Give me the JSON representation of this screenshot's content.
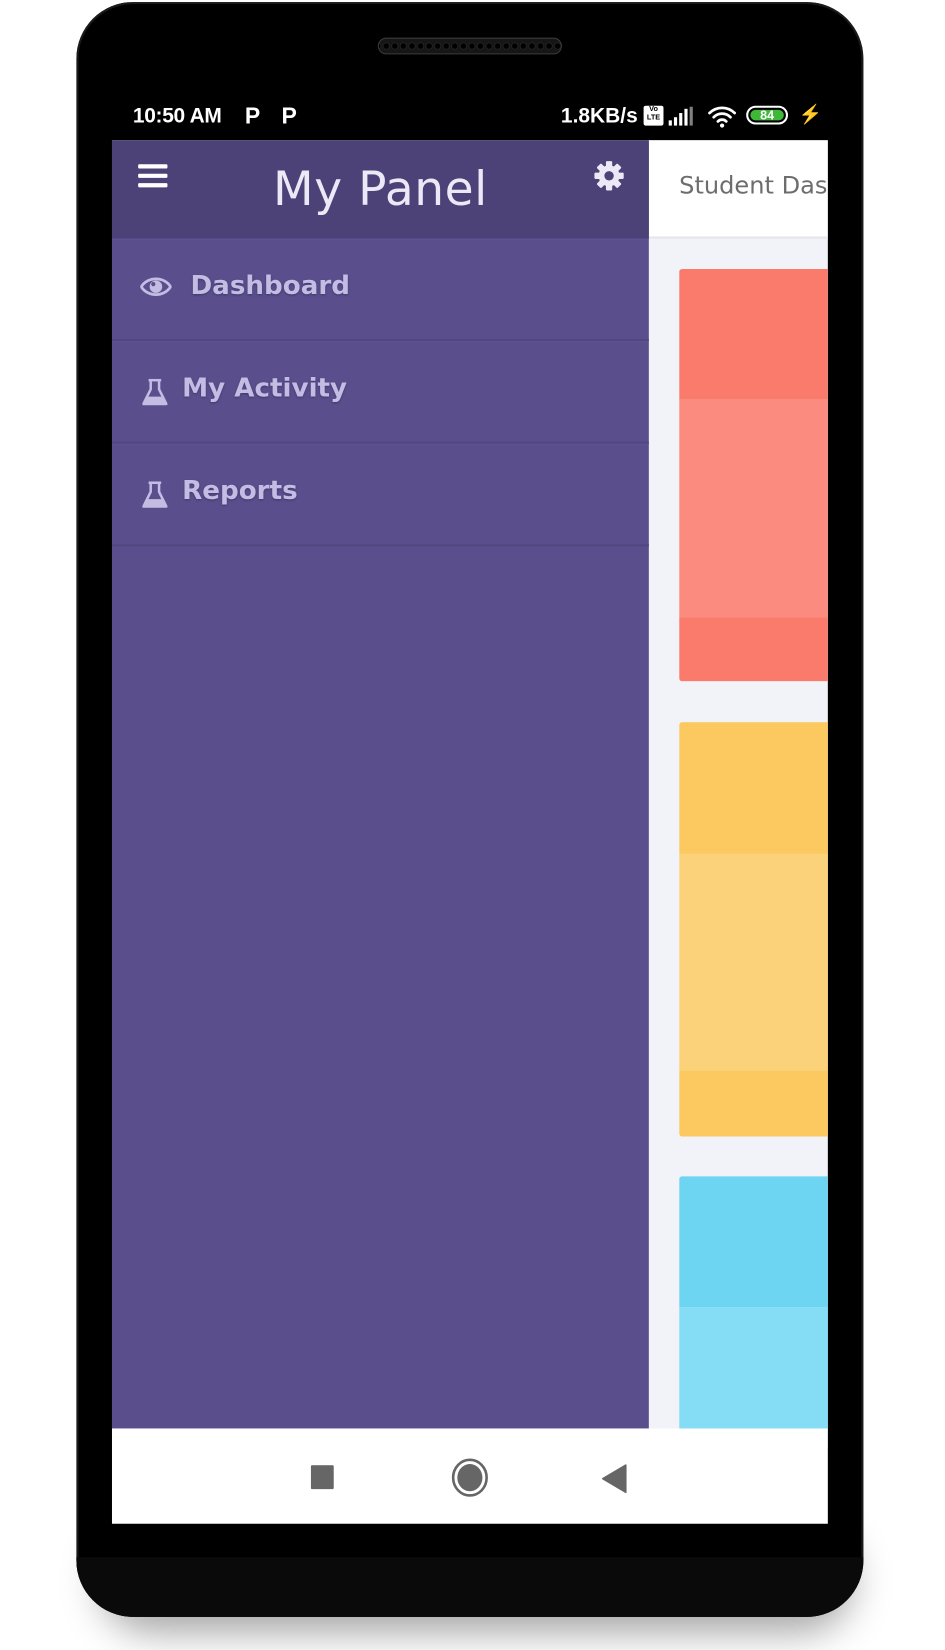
{
  "status_bar": {
    "time": "10:50 AM",
    "notification_icons": [
      "P",
      "P"
    ],
    "network_speed": "1.8KB/s",
    "volte_label": "Vo LTE",
    "battery_level": "84",
    "charging": true
  },
  "drawer": {
    "title": "My Panel",
    "menu_icon": "hamburger-icon",
    "settings_icon": "gear-icon",
    "items": [
      {
        "label": "Dashboard",
        "icon": "eye-icon"
      },
      {
        "label": "My Activity",
        "icon": "flask-icon"
      },
      {
        "label": "Reports",
        "icon": "flask-icon"
      }
    ]
  },
  "main": {
    "title": "Student Dashboard",
    "cards": [
      {
        "name": "red-card",
        "colors": {
          "top": "#fa7a6b",
          "middle": "#fb8b7e",
          "bottom": "#fa7a6b"
        }
      },
      {
        "name": "yellow-card",
        "colors": {
          "top": "#fbc95f",
          "middle": "#fbd27a",
          "bottom": "#fbc95f"
        }
      },
      {
        "name": "blue-card",
        "colors": {
          "top": "#6dd4f2",
          "middle": "#84dcf5"
        }
      }
    ]
  },
  "navigation_bar": {
    "buttons": [
      {
        "name": "recents",
        "icon": "square-icon"
      },
      {
        "name": "home",
        "icon": "circle-icon"
      },
      {
        "name": "back",
        "icon": "triangle-back-icon"
      }
    ]
  },
  "theme": {
    "drawer_bg": "#5a4f8c",
    "drawer_header_bg": "#4c4277",
    "drawer_text": "#c3bde3",
    "content_bg": "#f1f3f8"
  }
}
